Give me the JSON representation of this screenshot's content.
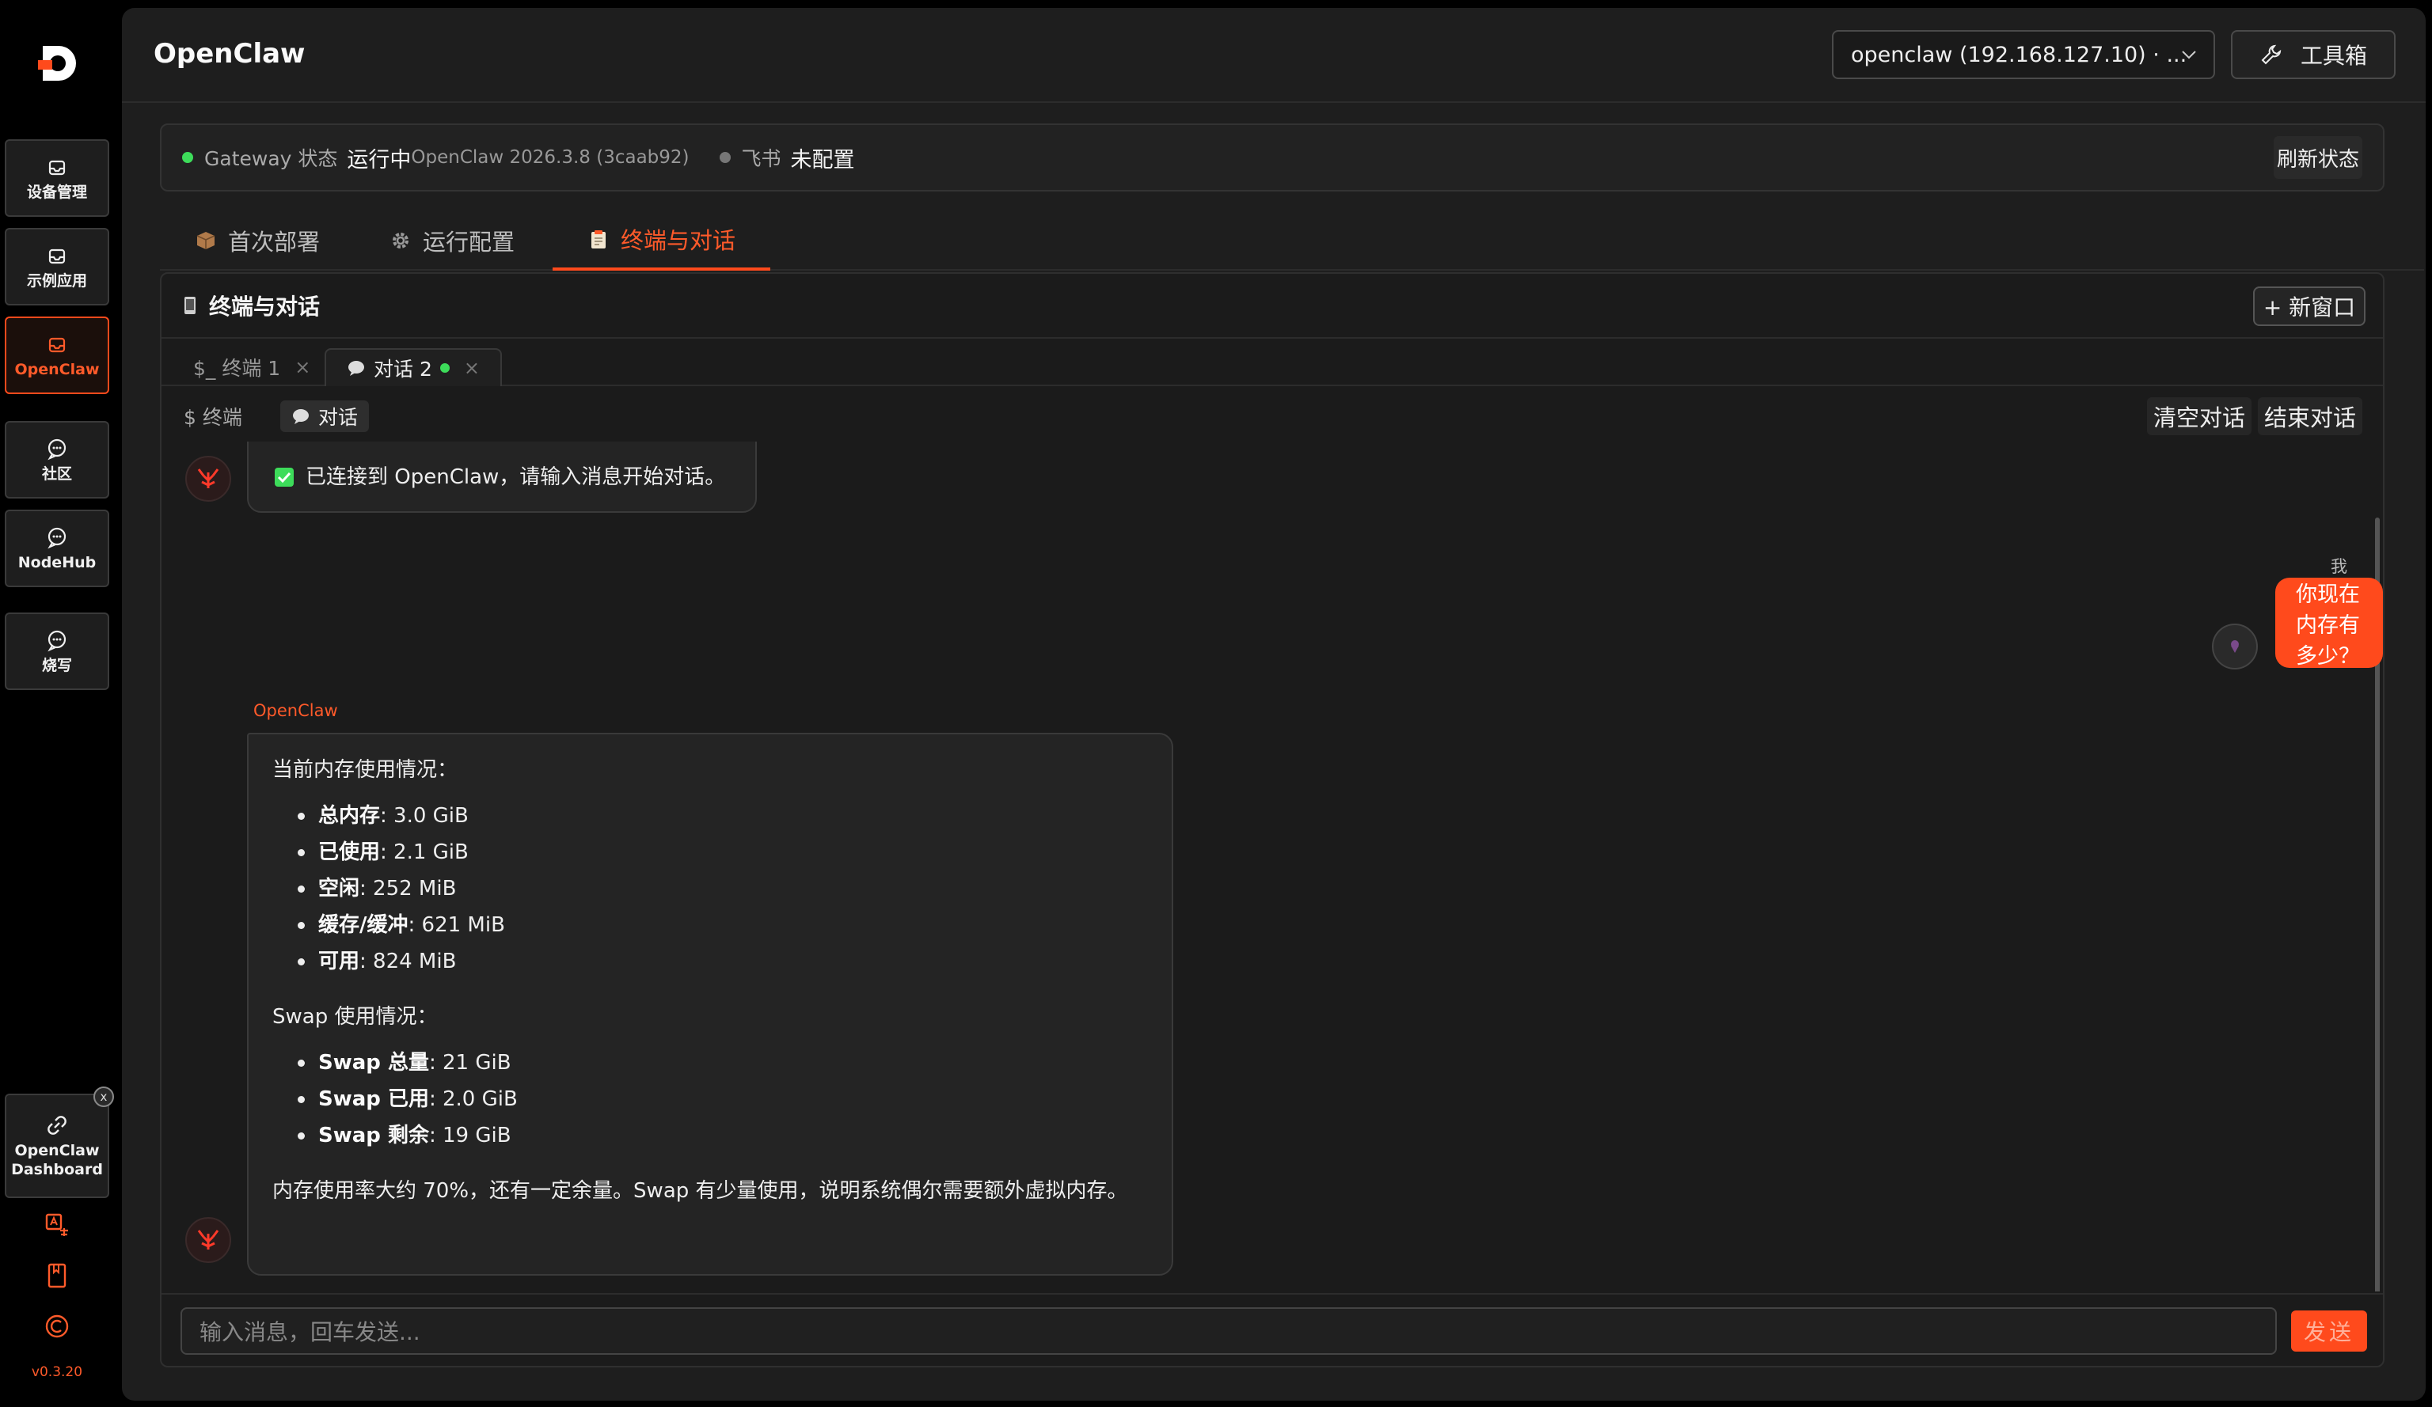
{
  "app": {
    "title": "OpenClaw",
    "accent": "#ff4a1c"
  },
  "sidebar": {
    "items": [
      {
        "label": "设备管理",
        "icon": "inbox-icon"
      },
      {
        "label": "示例应用",
        "icon": "inbox-icon"
      },
      {
        "label": "OpenClaw",
        "icon": "inbox-icon",
        "active": true
      },
      {
        "label": "社区",
        "icon": "chat-bubble-icon"
      },
      {
        "label": "NodeHub",
        "icon": "chat-bubble-icon"
      },
      {
        "label": "烧写",
        "icon": "chat-bubble-icon"
      }
    ],
    "dashboard": {
      "line1": "OpenClaw",
      "line2": "Dashboard",
      "close": "x"
    },
    "version": "v0.3.20"
  },
  "header": {
    "device_select": "openclaw (192.168.127.10) · ...",
    "toolbox_label": "工具箱"
  },
  "status": {
    "gateway_label": "Gateway 状态",
    "gateway_value": "运行中",
    "gateway_version": "OpenClaw 2026.3.8 (3caab92)",
    "feishu_label": "飞书",
    "feishu_value": "未配置",
    "refresh_label": "刷新状态",
    "gateway_color": "#3ddc5a",
    "feishu_color": "#777777"
  },
  "tabs": [
    {
      "label": "首次部署",
      "icon": "package-icon"
    },
    {
      "label": "运行配置",
      "icon": "gear-icon"
    },
    {
      "label": "终端与对话",
      "icon": "clipboard-icon",
      "active": true
    }
  ],
  "panel": {
    "title": "终端与对话",
    "new_window": "+ 新窗口",
    "subtabs": [
      {
        "label": "$_ 终端 1",
        "close": "×"
      },
      {
        "label": "对话 2",
        "close": "×",
        "active": true
      }
    ],
    "modes": [
      {
        "label": "$ 终端"
      },
      {
        "label": "对话",
        "active": true
      }
    ],
    "clear_label": "清空对话",
    "end_label": "结束对话"
  },
  "chat": {
    "system_message": "已连接到 OpenClaw，请输入消息开始对话。",
    "me_label": "我",
    "user_message": "你现在内存有多少？",
    "bot_name": "OpenClaw",
    "reply": {
      "intro": "当前内存使用情况：",
      "memory": [
        {
          "key": "总内存",
          "value": ": 3.0 GiB"
        },
        {
          "key": "已使用",
          "value": ": 2.1 GiB"
        },
        {
          "key": "空闲",
          "value": ": 252 MiB"
        },
        {
          "key": "缓存/缓冲",
          "value": ": 621 MiB"
        },
        {
          "key": "可用",
          "value": ": 824 MiB"
        }
      ],
      "swap_intro": "Swap 使用情况：",
      "swap": [
        {
          "key": "Swap 总量",
          "value": ": 21 GiB"
        },
        {
          "key": "Swap 已用",
          "value": ": 2.0 GiB"
        },
        {
          "key": "Swap 剩余",
          "value": ": 19 GiB"
        }
      ],
      "summary": "内存使用率大约 70%，还有一定余量。Swap 有少量使用，说明系统偶尔需要额外虚拟内存。"
    }
  },
  "composer": {
    "placeholder": "输入消息，回车发送...",
    "send_label": "发送"
  }
}
